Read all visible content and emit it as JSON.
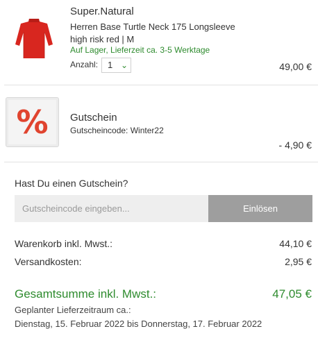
{
  "items": [
    {
      "brand": "Super.Natural",
      "name": "Herren Base Turtle Neck 175 Longsleeve high risk red | M",
      "stock": "Auf Lager, Lieferzeit ca. 3-5 Werktage",
      "qty_label": "Anzahl:",
      "qty_value": "1",
      "price": "49,00 €",
      "image_icon": "red-longsleeve-shirt",
      "image_color": "#d8261f"
    },
    {
      "title": "Gutschein",
      "code_line": "Gutscheincode: Winter22",
      "price": "- 4,90 €",
      "icon_symbol": "%",
      "icon_color": "#e0442f"
    }
  ],
  "voucher_form": {
    "question": "Hast Du einen Gutschein?",
    "placeholder": "Gutscheincode eingeben...",
    "button_label": "Einlösen"
  },
  "summary": {
    "cart_label": "Warenkorb inkl. Mwst.:",
    "cart_value": "44,10 €",
    "shipping_label": "Versandkosten:",
    "shipping_value": "2,95 €",
    "total_label": "Gesamtsumme inkl. Mwst.:",
    "total_value": "47,05 €",
    "delivery_label": "Geplanter Lieferzeitraum ca.:",
    "delivery_dates": "Dienstag, 15. Februar 2022 bis Donnerstag, 17. Februar 2022"
  },
  "colors": {
    "accent_green": "#2e8b2e",
    "button_gray": "#9e9e9e",
    "input_bg": "#eeeeee"
  }
}
